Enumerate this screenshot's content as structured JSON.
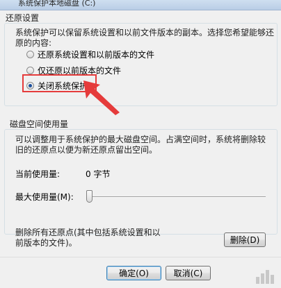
{
  "window": {
    "title": "系统保护本地磁盘 (C:)"
  },
  "restore_settings": {
    "group_title": "还原设置",
    "description": "系统保护可以保留系统设置和以前文件版本的副本。选择您希望能够还原的内容:",
    "options": [
      {
        "label": "还原系统设置和以前版本的文件",
        "checked": false
      },
      {
        "label": "仅还原以前版本的文件",
        "checked": false
      },
      {
        "label": "关闭系统保护",
        "checked": true
      }
    ]
  },
  "disk_usage": {
    "group_title": "磁盘空间使用量",
    "description": "可以调整用于系统保护的最大磁盘空间。占满空间时，系统将删除较旧的还原点以便为新还原点留出空间。",
    "current_usage_label": "当前使用量:",
    "current_usage_value": "0 字节",
    "max_usage_label": "最大使用量(M):",
    "max_usage_fraction": 0.0
  },
  "delete": {
    "description": "删除所有还原点(其中包括系统设置和以前版本的文件)。",
    "button_label": "删除(D)"
  },
  "footer": {
    "ok_label": "确定(O)",
    "cancel_label": "取消(C)"
  },
  "colors": {
    "annotation": "#e53b3b",
    "radio_dot": "#1c4f9c"
  }
}
